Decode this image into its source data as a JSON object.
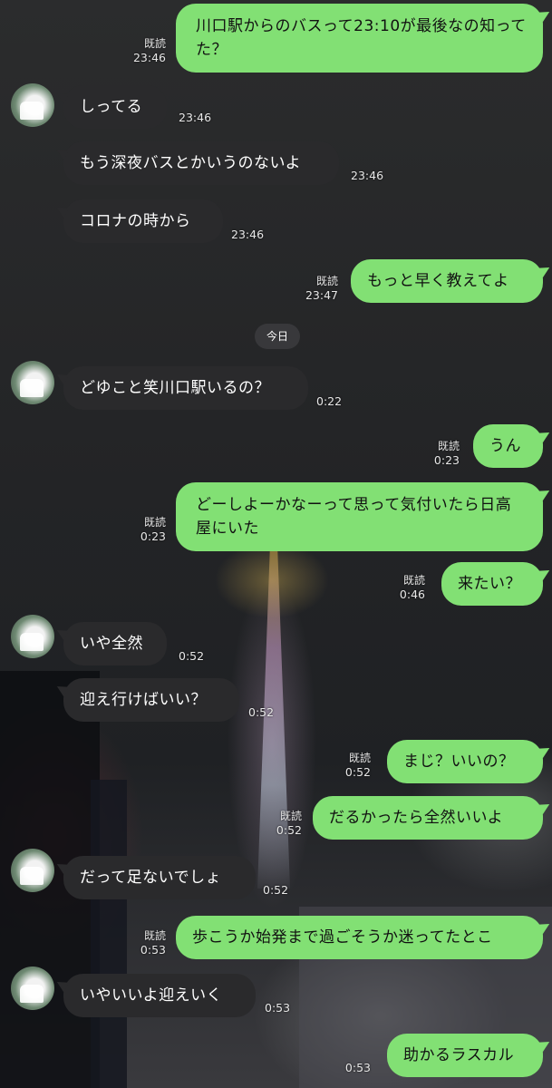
{
  "read_label": "既読",
  "date_separator": "今日",
  "colors": {
    "outgoing": "#82e074",
    "incoming": "#2a2a2c"
  },
  "messages": [
    {
      "side": "out",
      "text": "川口駅からのバスって23:10が最後なの知ってた？",
      "time": "23:46"
    },
    {
      "side": "in",
      "text": "しってる",
      "time": "23:46"
    },
    {
      "side": "in",
      "text": "もう深夜バスとかいうのないよ",
      "time": "23:46"
    },
    {
      "side": "in",
      "text": "コロナの時から",
      "time": "23:46"
    },
    {
      "side": "out",
      "text": "もっと早く教えてよ",
      "time": "23:47"
    },
    {
      "side": "in",
      "text": "どゆこと笑川口駅いるの？",
      "time": "0:22"
    },
    {
      "side": "out",
      "text": "うん",
      "time": "0:23"
    },
    {
      "side": "out",
      "text": "どーしよーかなーって思って気付いたら日高屋にいた",
      "time": "0:23"
    },
    {
      "side": "out",
      "text": "来たい？",
      "time": "0:46"
    },
    {
      "side": "in",
      "text": "いや全然",
      "time": "0:52"
    },
    {
      "side": "in",
      "text": "迎え行けばいい？",
      "time": "0:52"
    },
    {
      "side": "out",
      "text": "まじ？いいの？",
      "time": "0:52"
    },
    {
      "side": "out",
      "text": "だるかったら全然いいよ",
      "time": "0:52"
    },
    {
      "side": "in",
      "text": "だって足ないでしょ",
      "time": "0:52"
    },
    {
      "side": "out",
      "text": "歩こうか始発まで過ごそうか迷ってたとこ",
      "time": "0:53"
    },
    {
      "side": "in",
      "text": "いやいいよ迎えいく",
      "time": "0:53"
    },
    {
      "side": "out",
      "text": "助かるラスカル",
      "time": "0:53"
    }
  ]
}
